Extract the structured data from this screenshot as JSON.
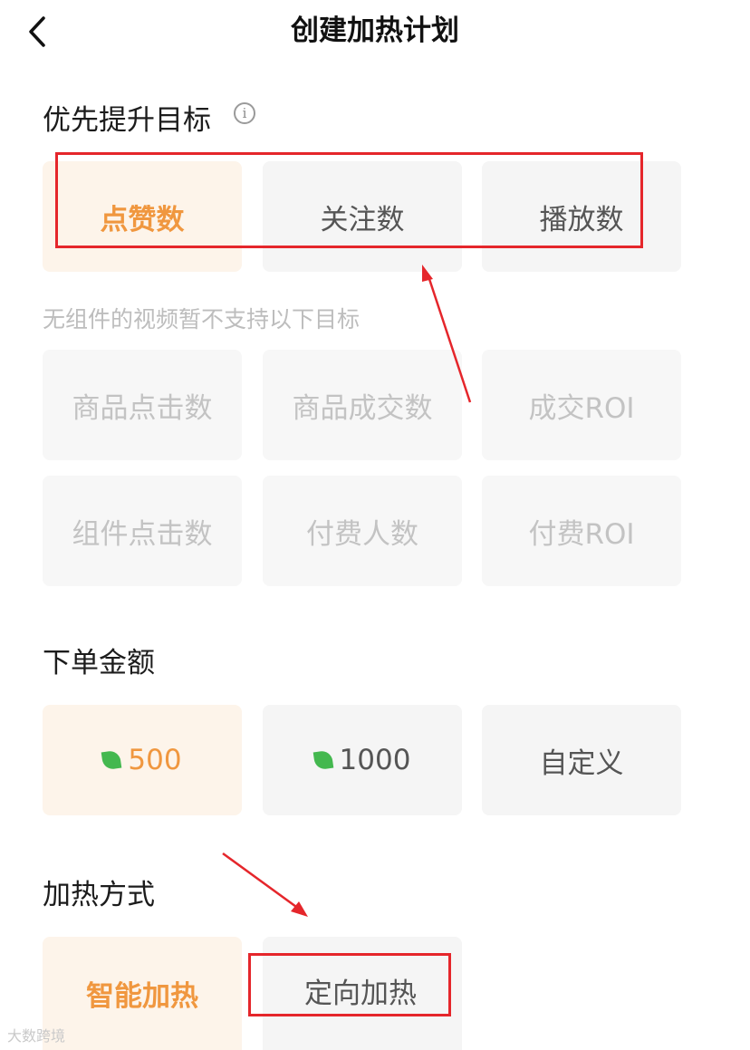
{
  "header": {
    "title": "创建加热计划",
    "back_icon": "chevron-left-icon"
  },
  "goal_section": {
    "title": "优先提升目标",
    "info_icon": "info-icon",
    "info_glyph": "i",
    "options": [
      "点赞数",
      "关注数",
      "播放数"
    ],
    "selected": "点赞数",
    "hint": "无组件的视频暂不支持以下目标",
    "disabled_options": [
      "商品点击数",
      "商品成交数",
      "成交ROI",
      "组件点击数",
      "付费人数",
      "付费ROI"
    ]
  },
  "amount_section": {
    "title": "下单金额",
    "options": [
      {
        "value": "500",
        "icon": "coin-leaf-icon"
      },
      {
        "value": "1000",
        "icon": "coin-leaf-icon"
      },
      {
        "value": "自定义"
      }
    ],
    "selected": "500",
    "coin_color": "#44b84f"
  },
  "method_section": {
    "title": "加热方式",
    "options": [
      "智能加热",
      "定向加热"
    ],
    "selected": "智能加热"
  },
  "annotations": {
    "highlight_color": "#e5262b"
  },
  "watermark": {
    "text": "大数跨境"
  },
  "colors": {
    "accent": "#f0973f",
    "selected_bg": "#fdf4ea",
    "card_bg": "#f5f5f5",
    "disabled_text": "#c3c3c3"
  }
}
